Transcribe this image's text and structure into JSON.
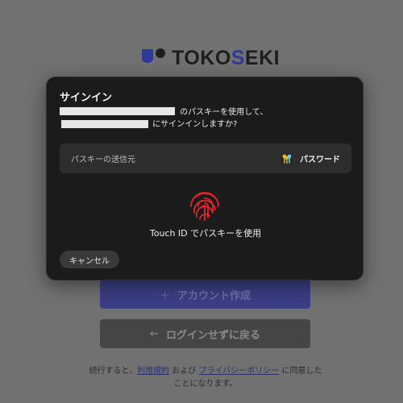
{
  "brand": {
    "logo_prefix": "TOKO",
    "logo_accent": "S",
    "logo_suffix": "EKI",
    "accent_color": "#2e3a9a"
  },
  "background": {
    "create_account": {
      "icon": "plus-icon",
      "glyph": "＋",
      "label": "アカウント作成"
    },
    "continue_without_login": {
      "icon": "arrow-left-icon",
      "glyph": "←",
      "label": "ログインせずに戻る"
    },
    "terms": {
      "before": "続行すると、",
      "terms_link": "利用規約",
      "middle": " および ",
      "privacy_link": "プライバシーポリシー",
      "after": " に同意したことになります。"
    }
  },
  "dialog": {
    "title": "サインイン",
    "message_part1": " のパスキーを使用して、",
    "message_part2": " にサインインしますか?",
    "source_label": "パスキーの送信元",
    "source_value": "パスワード",
    "source_icon": "keychain-icon",
    "touch_id_label": "Touch ID でパスキーを使用",
    "fingerprint_icon": "fingerprint-icon",
    "fingerprint_color": "#e3262e",
    "cancel_label": "キャンセル"
  }
}
